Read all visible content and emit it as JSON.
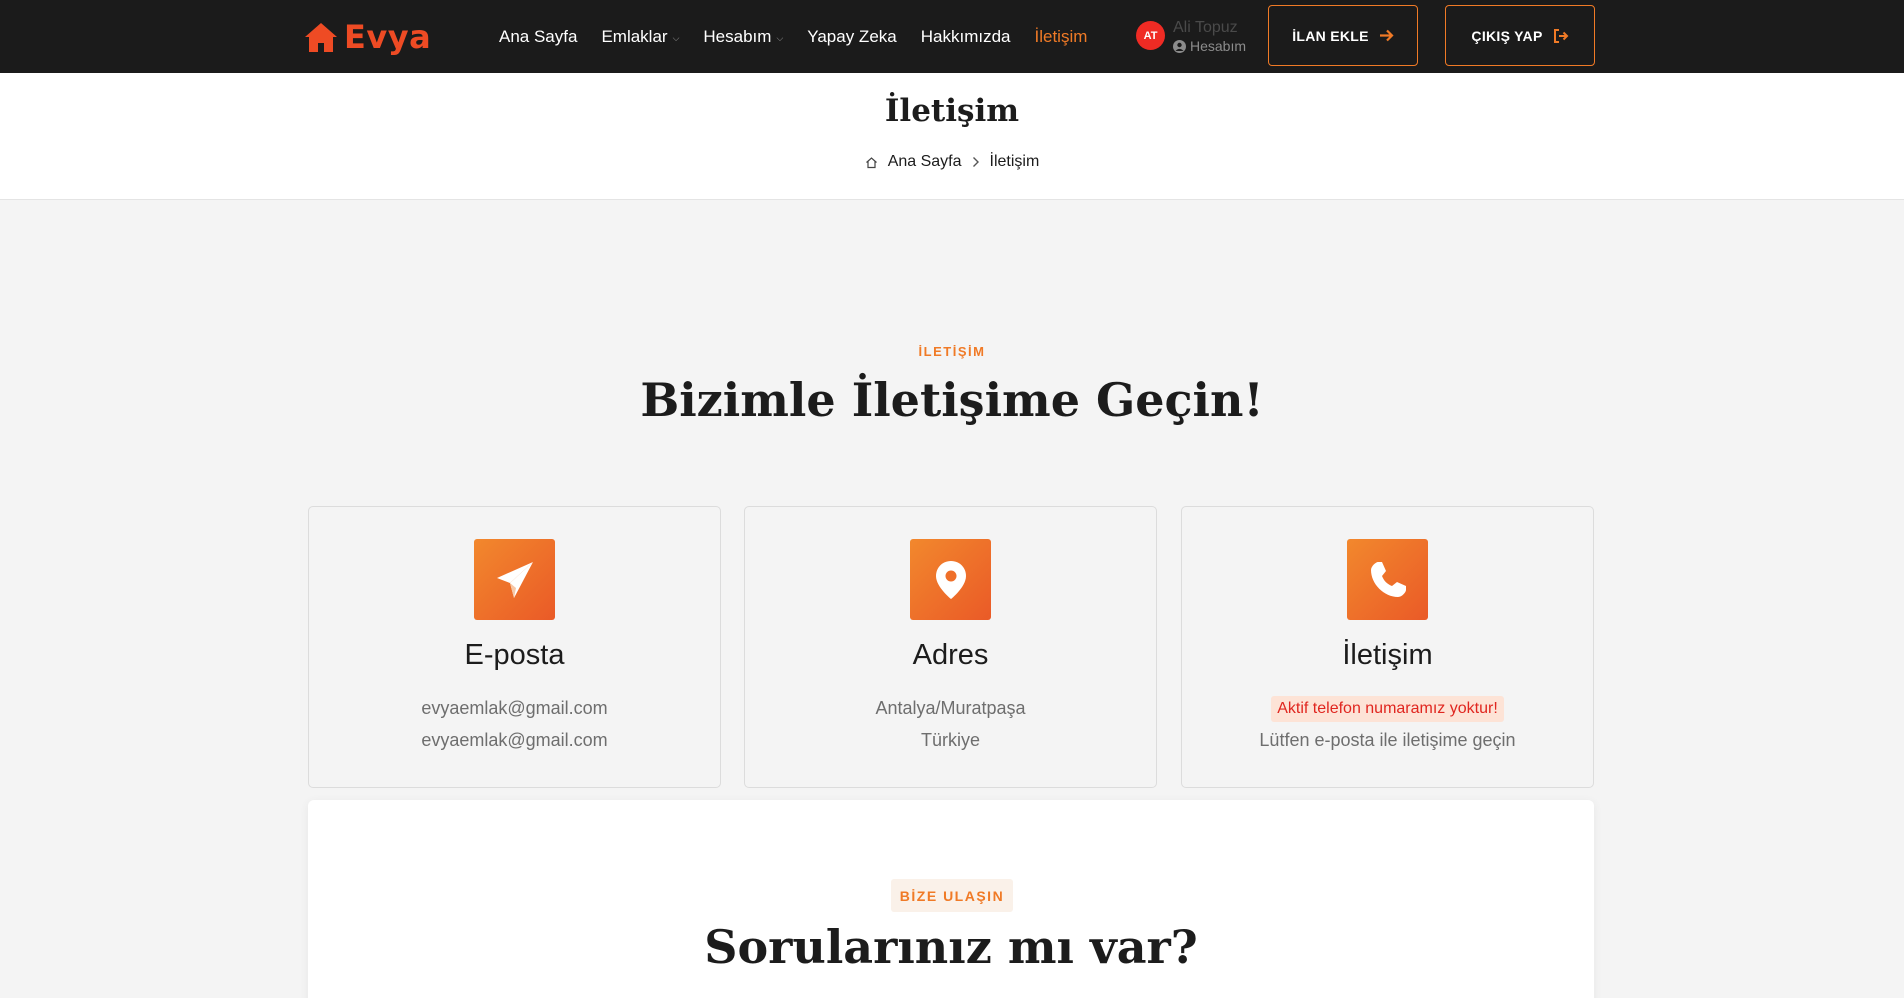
{
  "brand": {
    "name": "Evya",
    "accent": "#ee4b24",
    "orange": "#f07a26"
  },
  "nav": {
    "items": [
      {
        "label": "Ana Sayfa",
        "dropdown": false,
        "active": false
      },
      {
        "label": "Emlaklar",
        "dropdown": true,
        "active": false
      },
      {
        "label": "Hesabım",
        "dropdown": true,
        "active": false
      },
      {
        "label": "Yapay Zeka",
        "dropdown": false,
        "active": false
      },
      {
        "label": "Hakkımızda",
        "dropdown": false,
        "active": false
      },
      {
        "label": "İletişim",
        "dropdown": false,
        "active": true
      }
    ]
  },
  "user": {
    "initials": "AT",
    "name": "Ali Topuz",
    "sub": "Hesabım"
  },
  "header_buttons": {
    "add_listing": "İLAN EKLE",
    "logout": "ÇIKIŞ YAP"
  },
  "page": {
    "title": "İletişim",
    "breadcrumb": {
      "home": "Ana Sayfa",
      "current": "İletişim"
    }
  },
  "contact": {
    "eyebrow": "İLETİŞİM",
    "title": "Bizimle İletişime Geçin!",
    "cards": [
      {
        "icon": "paper-plane-icon",
        "title": "E-posta",
        "line1": "evyaemlak@gmail.com",
        "line2": "evyaemlak@gmail.com"
      },
      {
        "icon": "map-pin-icon",
        "title": "Adres",
        "line1": "Antalya/Muratpaşa",
        "line2": "Türkiye"
      },
      {
        "icon": "phone-icon",
        "title": "İletişim",
        "warning": "Aktif telefon numaramız yoktur!",
        "line2": "Lütfen e-posta ile iletişime geçin"
      }
    ]
  },
  "form": {
    "eyebrow": "BİZE ULAŞIN",
    "title": "Sorularınız mı var?"
  }
}
